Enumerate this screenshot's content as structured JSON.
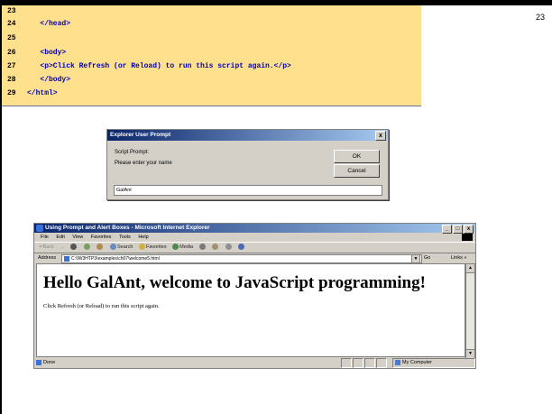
{
  "slide_number": "23",
  "code": {
    "lines": [
      {
        "num": "23",
        "text": ""
      },
      {
        "num": "24",
        "text": "   </head>"
      },
      {
        "num": "25",
        "text": ""
      },
      {
        "num": "26",
        "text": "   <body>"
      },
      {
        "num": "27",
        "text": "   <p>Click Refresh (or Reload) to run this script again.</p>"
      },
      {
        "num": "28",
        "text": "   </body>"
      },
      {
        "num": "29",
        "text": "</html>"
      }
    ]
  },
  "dialog": {
    "title": "Explorer User Prompt",
    "close_label": "x",
    "script_prompt_label": "Script Prompt:",
    "message": "Please enter your name",
    "ok_label": "OK",
    "cancel_label": "Cancel",
    "input_value": "GalAnt"
  },
  "browser": {
    "title": "Using Prompt and Alert Boxes - Microsoft Internet Explorer",
    "win_min": "_",
    "win_max": "□",
    "win_close": "x",
    "menu": [
      "File",
      "Edit",
      "View",
      "Favorites",
      "Tools",
      "Help"
    ],
    "toolbar": {
      "back": "⇐Back",
      "forward": "→",
      "search": "Search",
      "favorites": "Favorites",
      "media": "Media"
    },
    "address_label": "Address",
    "address_value": "C:\\IW3HTP3\\examples\\ch07\\welcome5.html",
    "go_label": "Go",
    "links_label": "Links »",
    "page_heading": "Hello GalAnt, welcome to JavaScript programming!",
    "page_paragraph": "Click Refresh (or Reload) to run this script again.",
    "status_text": "Done",
    "zone_text": "My Computer"
  }
}
